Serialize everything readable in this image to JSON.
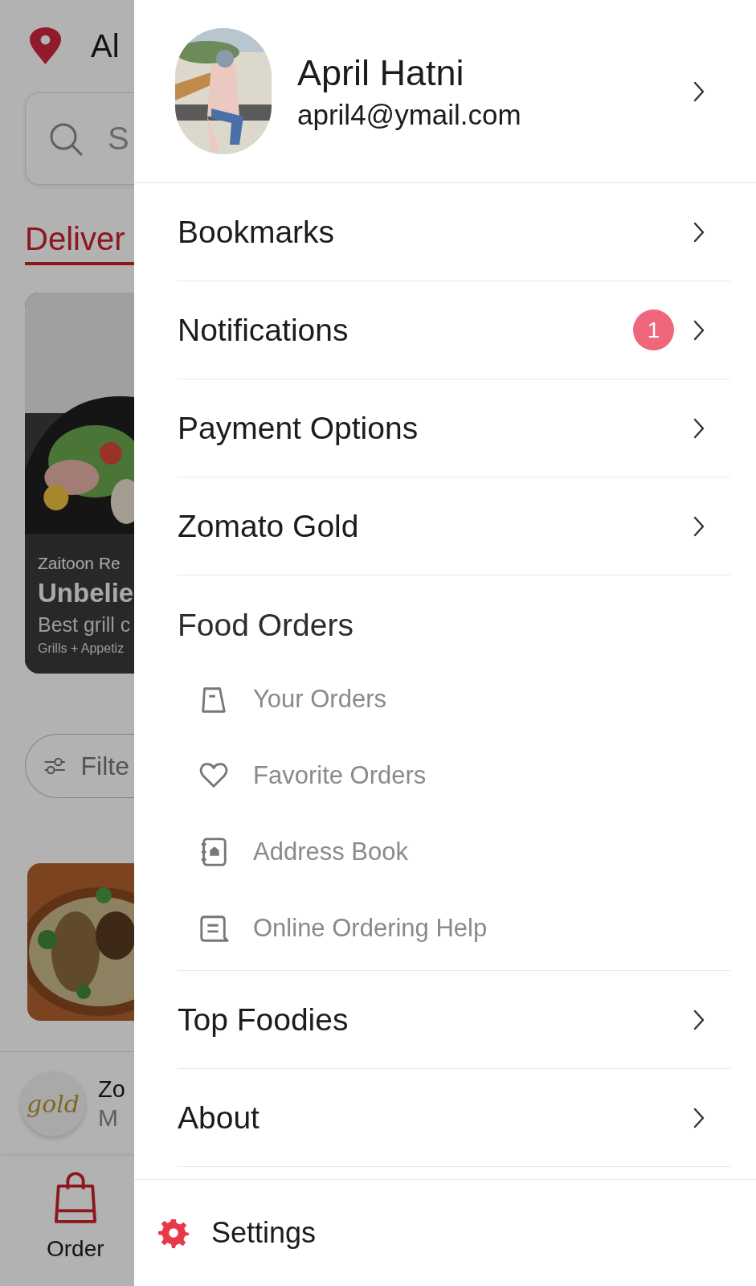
{
  "background": {
    "location": "Al",
    "search": {
      "placeholder": "S"
    },
    "tabs": [
      {
        "label": "Deliver",
        "selected": true
      }
    ],
    "promo_card": {
      "restaurant": "Zaitoon Re",
      "title": "Unbelie",
      "subtitle": "Best grill c",
      "tags": "Grills + Appetiz"
    },
    "filter_button": "Filte",
    "gold_banner": {
      "logo": "gold",
      "title": "Zo",
      "subtitle": "M"
    },
    "bottom_nav": [
      {
        "label": "Order",
        "selected": true
      }
    ]
  },
  "drawer": {
    "profile": {
      "name": "April Hatni",
      "email": "april4@ymail.com"
    },
    "items": [
      {
        "kind": "link",
        "label": "Bookmarks"
      },
      {
        "kind": "link",
        "label": "Notifications",
        "badge": "1"
      },
      {
        "kind": "link",
        "label": "Payment Options"
      },
      {
        "kind": "link",
        "label": "Zomato Gold"
      },
      {
        "kind": "section",
        "label": "Food Orders",
        "children": [
          {
            "label": "Your Orders"
          },
          {
            "label": "Favorite Orders"
          },
          {
            "label": "Address Book"
          },
          {
            "label": "Online Ordering Help"
          }
        ]
      },
      {
        "kind": "link",
        "label": "Top Foodies"
      },
      {
        "kind": "link",
        "label": "About"
      }
    ],
    "settings": "Settings"
  }
}
